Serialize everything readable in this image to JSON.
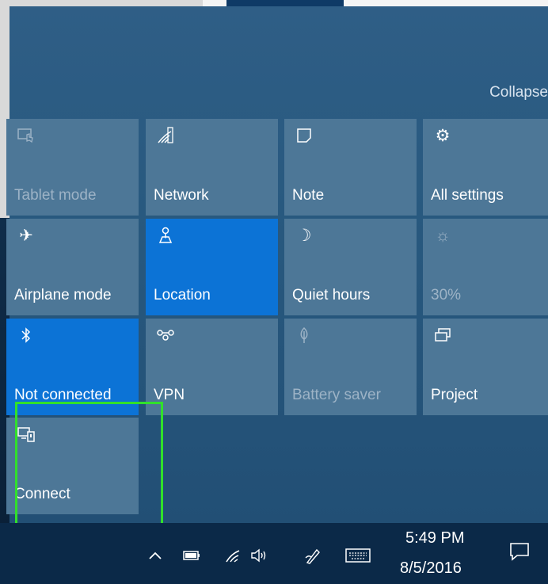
{
  "action_center": {
    "collapse_label": "Collapse",
    "tiles": [
      {
        "label": "Tablet mode",
        "icon": "tablet-mode-icon",
        "state": "disabled"
      },
      {
        "label": "Network",
        "icon": "network-icon",
        "state": "off"
      },
      {
        "label": "Note",
        "icon": "note-icon",
        "state": "off"
      },
      {
        "label": "All settings",
        "icon": "settings-gear-icon",
        "state": "off"
      },
      {
        "label": "Airplane mode",
        "icon": "airplane-icon",
        "state": "off"
      },
      {
        "label": "Location",
        "icon": "location-icon",
        "state": "on"
      },
      {
        "label": "Quiet hours",
        "icon": "moon-icon",
        "state": "off"
      },
      {
        "label": "30%",
        "icon": "brightness-icon",
        "state": "disabled"
      },
      {
        "label": "Not connected",
        "icon": "bluetooth-icon",
        "state": "on"
      },
      {
        "label": "VPN",
        "icon": "vpn-icon",
        "state": "off"
      },
      {
        "label": "Battery saver",
        "icon": "battery-saver-icon",
        "state": "disabled"
      },
      {
        "label": "Project",
        "icon": "project-icon",
        "state": "off"
      },
      {
        "label": "Connect",
        "icon": "connect-icon",
        "state": "off"
      }
    ],
    "colors": {
      "tile_off": "#4d7797",
      "tile_on": "#0c73d6",
      "highlight": "#31e02b"
    }
  },
  "taskbar": {
    "tray_icons": [
      "show-hidden-icons-chevron",
      "battery-icon",
      "wifi-icon",
      "volume-icon",
      "pen-icon",
      "touch-keyboard-icon"
    ],
    "clock": {
      "time": "5:49 PM",
      "date": "8/5/2016"
    },
    "notification_icon": "action-center-icon"
  }
}
